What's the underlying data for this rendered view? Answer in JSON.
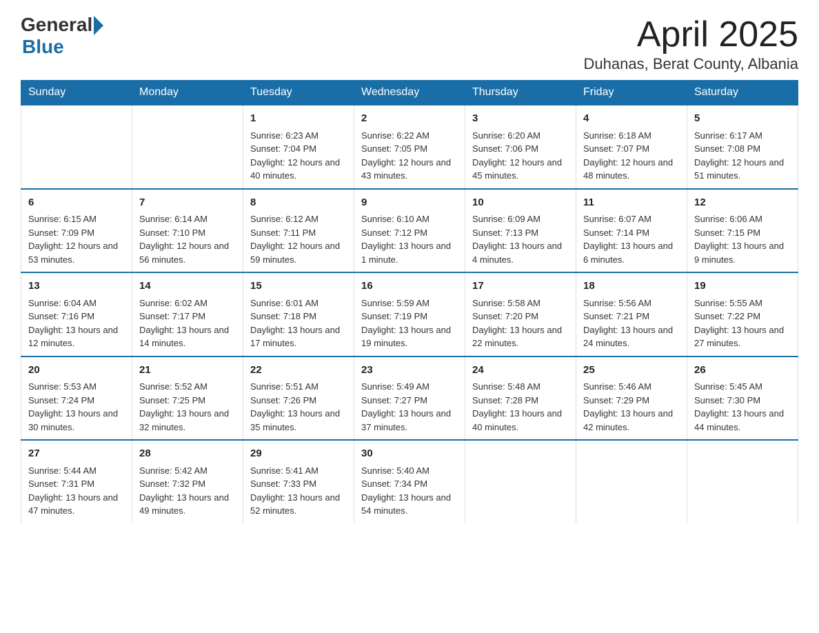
{
  "logo": {
    "general": "General",
    "blue": "Blue"
  },
  "title": "April 2025",
  "subtitle": "Duhanas, Berat County, Albania",
  "weekdays": [
    "Sunday",
    "Monday",
    "Tuesday",
    "Wednesday",
    "Thursday",
    "Friday",
    "Saturday"
  ],
  "weeks": [
    [
      {
        "day": "",
        "sunrise": "",
        "sunset": "",
        "daylight": ""
      },
      {
        "day": "",
        "sunrise": "",
        "sunset": "",
        "daylight": ""
      },
      {
        "day": "1",
        "sunrise": "Sunrise: 6:23 AM",
        "sunset": "Sunset: 7:04 PM",
        "daylight": "Daylight: 12 hours and 40 minutes."
      },
      {
        "day": "2",
        "sunrise": "Sunrise: 6:22 AM",
        "sunset": "Sunset: 7:05 PM",
        "daylight": "Daylight: 12 hours and 43 minutes."
      },
      {
        "day": "3",
        "sunrise": "Sunrise: 6:20 AM",
        "sunset": "Sunset: 7:06 PM",
        "daylight": "Daylight: 12 hours and 45 minutes."
      },
      {
        "day": "4",
        "sunrise": "Sunrise: 6:18 AM",
        "sunset": "Sunset: 7:07 PM",
        "daylight": "Daylight: 12 hours and 48 minutes."
      },
      {
        "day": "5",
        "sunrise": "Sunrise: 6:17 AM",
        "sunset": "Sunset: 7:08 PM",
        "daylight": "Daylight: 12 hours and 51 minutes."
      }
    ],
    [
      {
        "day": "6",
        "sunrise": "Sunrise: 6:15 AM",
        "sunset": "Sunset: 7:09 PM",
        "daylight": "Daylight: 12 hours and 53 minutes."
      },
      {
        "day": "7",
        "sunrise": "Sunrise: 6:14 AM",
        "sunset": "Sunset: 7:10 PM",
        "daylight": "Daylight: 12 hours and 56 minutes."
      },
      {
        "day": "8",
        "sunrise": "Sunrise: 6:12 AM",
        "sunset": "Sunset: 7:11 PM",
        "daylight": "Daylight: 12 hours and 59 minutes."
      },
      {
        "day": "9",
        "sunrise": "Sunrise: 6:10 AM",
        "sunset": "Sunset: 7:12 PM",
        "daylight": "Daylight: 13 hours and 1 minute."
      },
      {
        "day": "10",
        "sunrise": "Sunrise: 6:09 AM",
        "sunset": "Sunset: 7:13 PM",
        "daylight": "Daylight: 13 hours and 4 minutes."
      },
      {
        "day": "11",
        "sunrise": "Sunrise: 6:07 AM",
        "sunset": "Sunset: 7:14 PM",
        "daylight": "Daylight: 13 hours and 6 minutes."
      },
      {
        "day": "12",
        "sunrise": "Sunrise: 6:06 AM",
        "sunset": "Sunset: 7:15 PM",
        "daylight": "Daylight: 13 hours and 9 minutes."
      }
    ],
    [
      {
        "day": "13",
        "sunrise": "Sunrise: 6:04 AM",
        "sunset": "Sunset: 7:16 PM",
        "daylight": "Daylight: 13 hours and 12 minutes."
      },
      {
        "day": "14",
        "sunrise": "Sunrise: 6:02 AM",
        "sunset": "Sunset: 7:17 PM",
        "daylight": "Daylight: 13 hours and 14 minutes."
      },
      {
        "day": "15",
        "sunrise": "Sunrise: 6:01 AM",
        "sunset": "Sunset: 7:18 PM",
        "daylight": "Daylight: 13 hours and 17 minutes."
      },
      {
        "day": "16",
        "sunrise": "Sunrise: 5:59 AM",
        "sunset": "Sunset: 7:19 PM",
        "daylight": "Daylight: 13 hours and 19 minutes."
      },
      {
        "day": "17",
        "sunrise": "Sunrise: 5:58 AM",
        "sunset": "Sunset: 7:20 PM",
        "daylight": "Daylight: 13 hours and 22 minutes."
      },
      {
        "day": "18",
        "sunrise": "Sunrise: 5:56 AM",
        "sunset": "Sunset: 7:21 PM",
        "daylight": "Daylight: 13 hours and 24 minutes."
      },
      {
        "day": "19",
        "sunrise": "Sunrise: 5:55 AM",
        "sunset": "Sunset: 7:22 PM",
        "daylight": "Daylight: 13 hours and 27 minutes."
      }
    ],
    [
      {
        "day": "20",
        "sunrise": "Sunrise: 5:53 AM",
        "sunset": "Sunset: 7:24 PM",
        "daylight": "Daylight: 13 hours and 30 minutes."
      },
      {
        "day": "21",
        "sunrise": "Sunrise: 5:52 AM",
        "sunset": "Sunset: 7:25 PM",
        "daylight": "Daylight: 13 hours and 32 minutes."
      },
      {
        "day": "22",
        "sunrise": "Sunrise: 5:51 AM",
        "sunset": "Sunset: 7:26 PM",
        "daylight": "Daylight: 13 hours and 35 minutes."
      },
      {
        "day": "23",
        "sunrise": "Sunrise: 5:49 AM",
        "sunset": "Sunset: 7:27 PM",
        "daylight": "Daylight: 13 hours and 37 minutes."
      },
      {
        "day": "24",
        "sunrise": "Sunrise: 5:48 AM",
        "sunset": "Sunset: 7:28 PM",
        "daylight": "Daylight: 13 hours and 40 minutes."
      },
      {
        "day": "25",
        "sunrise": "Sunrise: 5:46 AM",
        "sunset": "Sunset: 7:29 PM",
        "daylight": "Daylight: 13 hours and 42 minutes."
      },
      {
        "day": "26",
        "sunrise": "Sunrise: 5:45 AM",
        "sunset": "Sunset: 7:30 PM",
        "daylight": "Daylight: 13 hours and 44 minutes."
      }
    ],
    [
      {
        "day": "27",
        "sunrise": "Sunrise: 5:44 AM",
        "sunset": "Sunset: 7:31 PM",
        "daylight": "Daylight: 13 hours and 47 minutes."
      },
      {
        "day": "28",
        "sunrise": "Sunrise: 5:42 AM",
        "sunset": "Sunset: 7:32 PM",
        "daylight": "Daylight: 13 hours and 49 minutes."
      },
      {
        "day": "29",
        "sunrise": "Sunrise: 5:41 AM",
        "sunset": "Sunset: 7:33 PM",
        "daylight": "Daylight: 13 hours and 52 minutes."
      },
      {
        "day": "30",
        "sunrise": "Sunrise: 5:40 AM",
        "sunset": "Sunset: 7:34 PM",
        "daylight": "Daylight: 13 hours and 54 minutes."
      },
      {
        "day": "",
        "sunrise": "",
        "sunset": "",
        "daylight": ""
      },
      {
        "day": "",
        "sunrise": "",
        "sunset": "",
        "daylight": ""
      },
      {
        "day": "",
        "sunrise": "",
        "sunset": "",
        "daylight": ""
      }
    ]
  ],
  "accent_color": "#1a6ea8"
}
